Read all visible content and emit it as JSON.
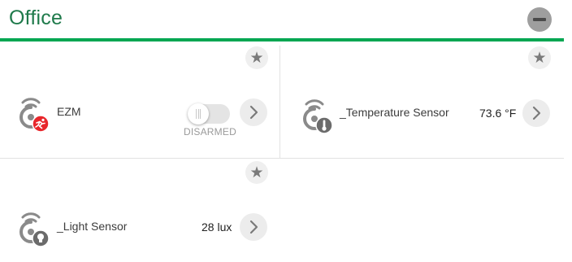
{
  "room": {
    "title": "Office"
  },
  "devices": [
    {
      "name": "EZM",
      "status": "DISARMED",
      "badge_icon": "motion-figure-icon",
      "badge_color": "#e8262b"
    },
    {
      "name": "_Temperature Sensor",
      "value": "73.6 °F",
      "badge_icon": "thermometer-icon",
      "badge_color": "#6b6b6b"
    },
    {
      "name": "_Light Sensor",
      "value": "28 lux",
      "badge_icon": "light-bulb-icon",
      "badge_color": "#6b6b6b"
    }
  ],
  "colors": {
    "accent": "#00a651",
    "title": "#1f7a4b"
  }
}
